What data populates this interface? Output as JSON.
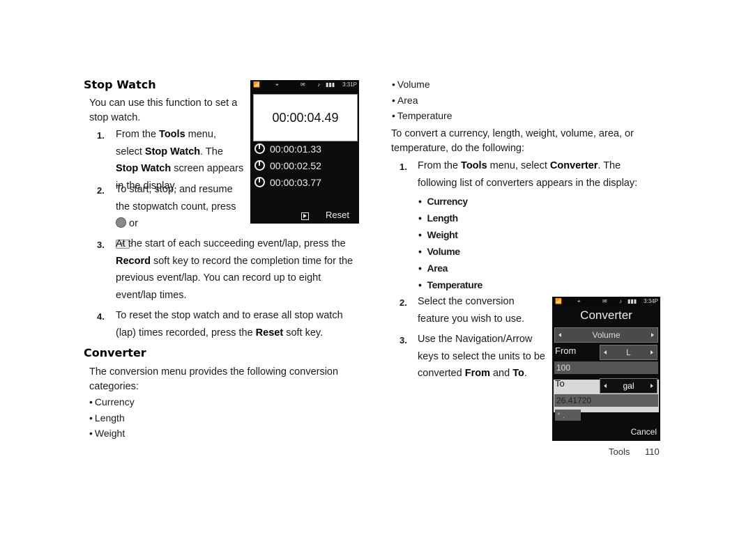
{
  "stopwatch": {
    "heading": "Stop Watch",
    "intro": "You can use this function to set a stop watch.",
    "steps": [
      {
        "num": "1.",
        "parts": [
          "From the ",
          "Tools",
          " menu, select ",
          "Stop Watch",
          ". The ",
          "Stop Watch",
          " screen appears in the display."
        ]
      },
      {
        "num": "2.",
        "parts": [
          "To start, stop, and resume the stopwatch count, press ",
          " or ",
          "."
        ]
      },
      {
        "num": "3.",
        "parts": [
          "At the start of each succeeding event/lap, press the ",
          "Record",
          " soft key to record the completion time for the previous event/lap. You can record up to eight event/lap times."
        ]
      },
      {
        "num": "4.",
        "parts": [
          "To reset the stop watch and to erase all stop watch (lap) times recorded, press the ",
          "Reset",
          " soft key."
        ]
      }
    ],
    "ok_key_label": "ok",
    "screen": {
      "status_time": "3:31P",
      "main_time": "00:00:04.49",
      "laps": [
        "00:00:01.33",
        "00:00:02.52",
        "00:00:03.77"
      ],
      "soft_right": "Reset"
    }
  },
  "converter": {
    "heading": "Converter",
    "intro": "The conversion menu provides the following conversion categories:",
    "categories": [
      "Currency",
      "Length",
      "Weight",
      "Volume",
      "Area",
      "Temperature"
    ],
    "how_to": "To convert a currency, length, weight, volume, area, or temperature, do the following:",
    "steps": [
      {
        "num": "1.",
        "parts": [
          "From the ",
          "Tools",
          " menu, select ",
          "Converter",
          ". The following list of converters appears in the display:"
        ]
      },
      {
        "num": "2.",
        "parts": [
          "Select the conversion feature you wish to use."
        ]
      },
      {
        "num": "3.",
        "parts": [
          "Use the Navigation/Arrow keys to select the units to be converted ",
          "From",
          " and ",
          "To",
          "."
        ]
      }
    ],
    "list": [
      "Currency",
      "Length",
      "Weight",
      "Volume",
      "Area",
      "Temperature"
    ],
    "screen": {
      "status_time": "3:34P",
      "title": "Converter",
      "category": "Volume",
      "from_label": "From",
      "from_unit": "L",
      "from_value": "100",
      "to_label": "To",
      "to_unit": "gal",
      "to_value": "26.41720",
      "symbol_key": "* .",
      "soft_right": "Cancel"
    }
  },
  "footer": {
    "section": "Tools",
    "page": "110"
  }
}
